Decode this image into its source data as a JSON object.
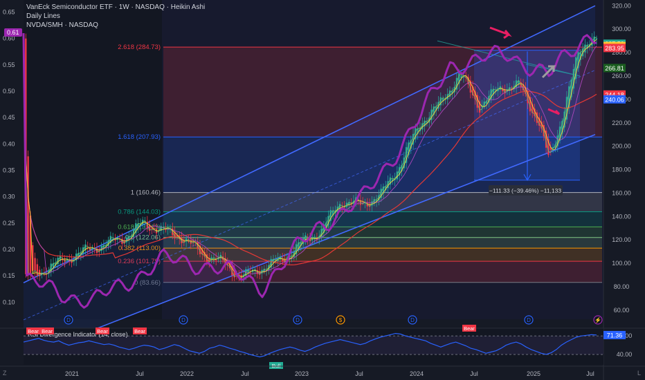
{
  "header": {
    "title": "VanEck Semiconductor ETF · 1W · NASDAQ · Heikin Ashi",
    "indicator": "Daily Lines",
    "ratio": "NVDA/SMH · NASDAQ",
    "ratio_value": "0.61"
  },
  "chart_data": {
    "type": "candlestick",
    "symbol": "SMH",
    "interval": "1W",
    "x_labels": [
      "2021",
      "Jul",
      "2022",
      "Jul",
      "2023",
      "Jul",
      "2024",
      "Jul",
      "2025",
      "Jul"
    ],
    "y_axis_right": {
      "min": 60,
      "max": 320,
      "ticks": [
        320,
        300,
        280,
        260,
        240,
        220,
        200,
        180,
        160,
        140,
        120,
        100,
        80,
        60
      ]
    },
    "y_axis_left": {
      "ticks": [
        "0.65",
        "0.60",
        "0.55",
        "0.50",
        "0.45",
        "0.40",
        "0.35",
        "0.30",
        "0.25",
        "0.20",
        "0.15",
        "0.10"
      ]
    },
    "price_path": [
      {
        "t": "2020-11",
        "v": 86
      },
      {
        "t": "2021-01",
        "v": 94
      },
      {
        "t": "2021-03",
        "v": 103
      },
      {
        "t": "2021-05",
        "v": 110
      },
      {
        "t": "2021-07",
        "v": 116
      },
      {
        "t": "2021-09",
        "v": 121
      },
      {
        "t": "2021-11",
        "v": 134
      },
      {
        "t": "2022-01",
        "v": 128
      },
      {
        "t": "2022-03",
        "v": 122
      },
      {
        "t": "2022-05",
        "v": 108
      },
      {
        "t": "2022-07",
        "v": 101
      },
      {
        "t": "2022-09",
        "v": 88
      },
      {
        "t": "2022-11",
        "v": 96
      },
      {
        "t": "2023-01",
        "v": 103
      },
      {
        "t": "2023-03",
        "v": 117
      },
      {
        "t": "2023-05",
        "v": 128
      },
      {
        "t": "2023-07",
        "v": 153
      },
      {
        "t": "2023-09",
        "v": 150
      },
      {
        "t": "2023-11",
        "v": 158
      },
      {
        "t": "2024-01",
        "v": 185
      },
      {
        "t": "2024-03",
        "v": 220
      },
      {
        "t": "2024-05",
        "v": 236
      },
      {
        "t": "2024-07",
        "v": 262
      },
      {
        "t": "2024-09",
        "v": 234
      },
      {
        "t": "2024-11",
        "v": 250
      },
      {
        "t": "2025-01",
        "v": 252
      },
      {
        "t": "2025-03",
        "v": 220
      },
      {
        "t": "2025-04",
        "v": 188
      },
      {
        "t": "2025-05",
        "v": 215
      },
      {
        "t": "2025-07",
        "v": 280
      },
      {
        "t": "2025-08",
        "v": 292
      }
    ],
    "ratio_path": [
      {
        "t": "2020-11",
        "v": 0.14
      },
      {
        "t": "2021-06",
        "v": 0.1
      },
      {
        "t": "2022-01",
        "v": 0.18
      },
      {
        "t": "2022-06",
        "v": 0.17
      },
      {
        "t": "2022-11",
        "v": 0.13
      },
      {
        "t": "2023-05",
        "v": 0.25
      },
      {
        "t": "2023-09",
        "v": 0.29
      },
      {
        "t": "2024-03",
        "v": 0.45
      },
      {
        "t": "2024-06",
        "v": 0.55
      },
      {
        "t": "2024-12",
        "v": 0.57
      },
      {
        "t": "2025-04",
        "v": 0.53
      },
      {
        "t": "2025-08",
        "v": 0.61
      }
    ],
    "fib_levels": [
      {
        "label": "2.618 (284.73)",
        "value": 284.73,
        "color": "#f23645"
      },
      {
        "label": "1.618 (207.93)",
        "value": 207.93,
        "color": "#2962ff"
      },
      {
        "label": "1 (160.46)",
        "value": 160.46,
        "color": "#b2b5be"
      },
      {
        "label": "0.786 (144.03)",
        "value": 144.03,
        "color": "#089981"
      },
      {
        "label": "0.618 (131.13)",
        "value": 131.13,
        "color": "#4caf50"
      },
      {
        "label": "0.5 (122.06)",
        "value": 122.06,
        "color": "#81c784"
      },
      {
        "label": "0.382 (113.00)",
        "value": 113.0,
        "color": "#ff9800"
      },
      {
        "label": "0.236 (101.79)",
        "value": 101.79,
        "color": "#f23645"
      },
      {
        "label": "0 (83.66)",
        "value": 83.66,
        "color": "#787b86"
      }
    ],
    "price_badges": [
      {
        "text": "287.58",
        "value": 287.58,
        "bg": "#22ab94"
      },
      {
        "text": "285.64",
        "value": 285.64,
        "bg": "#fbc02d"
      },
      {
        "text": "283.95",
        "value": 283.95,
        "bg": "#f23645"
      },
      {
        "text": "266.81",
        "value": 266.81,
        "bg": "#1b5e20"
      },
      {
        "text": "244.18",
        "value": 244.18,
        "bg": "#f23645"
      },
      {
        "text": "240.06",
        "value": 240.06,
        "bg": "#2962ff"
      }
    ],
    "measure_label": "−111.33 (−39.46%) −11,133",
    "events": [
      "D",
      "D",
      "D",
      "$",
      "D",
      "D",
      "⚡"
    ],
    "rsi": {
      "title": "RSI Divergence Indicator (14, close)",
      "ticks": [
        70,
        40
      ],
      "value_badge": "71.36",
      "bear_labels": [
        "Bear",
        "Bear",
        "Bear",
        "Bear",
        "Bear"
      ],
      "bull_labels": [
        "Bull"
      ],
      "series": [
        60,
        62,
        64,
        66,
        63,
        61,
        60,
        62,
        58,
        55,
        57,
        59,
        60,
        62,
        60,
        58,
        56,
        57,
        55,
        52,
        50,
        48,
        50,
        53,
        55,
        54,
        52,
        48,
        50,
        53,
        56,
        54,
        50,
        46,
        44,
        42,
        45,
        50,
        52,
        55,
        53,
        50,
        48,
        45,
        43,
        40,
        38,
        36,
        38,
        42,
        45,
        48,
        50,
        52,
        50,
        47,
        45,
        48,
        52,
        55,
        58,
        60,
        62,
        64,
        62,
        60,
        58,
        56,
        58,
        62,
        65,
        68,
        70,
        72,
        74,
        73,
        70,
        68,
        66,
        64,
        62,
        58,
        55,
        52,
        55,
        58,
        60,
        57,
        54,
        50,
        48,
        45,
        42,
        44,
        46,
        50,
        55,
        58,
        60,
        57,
        52,
        48,
        45,
        42,
        40,
        43,
        48,
        55,
        60,
        64,
        68,
        70,
        71,
        72,
        71.36
      ]
    }
  }
}
